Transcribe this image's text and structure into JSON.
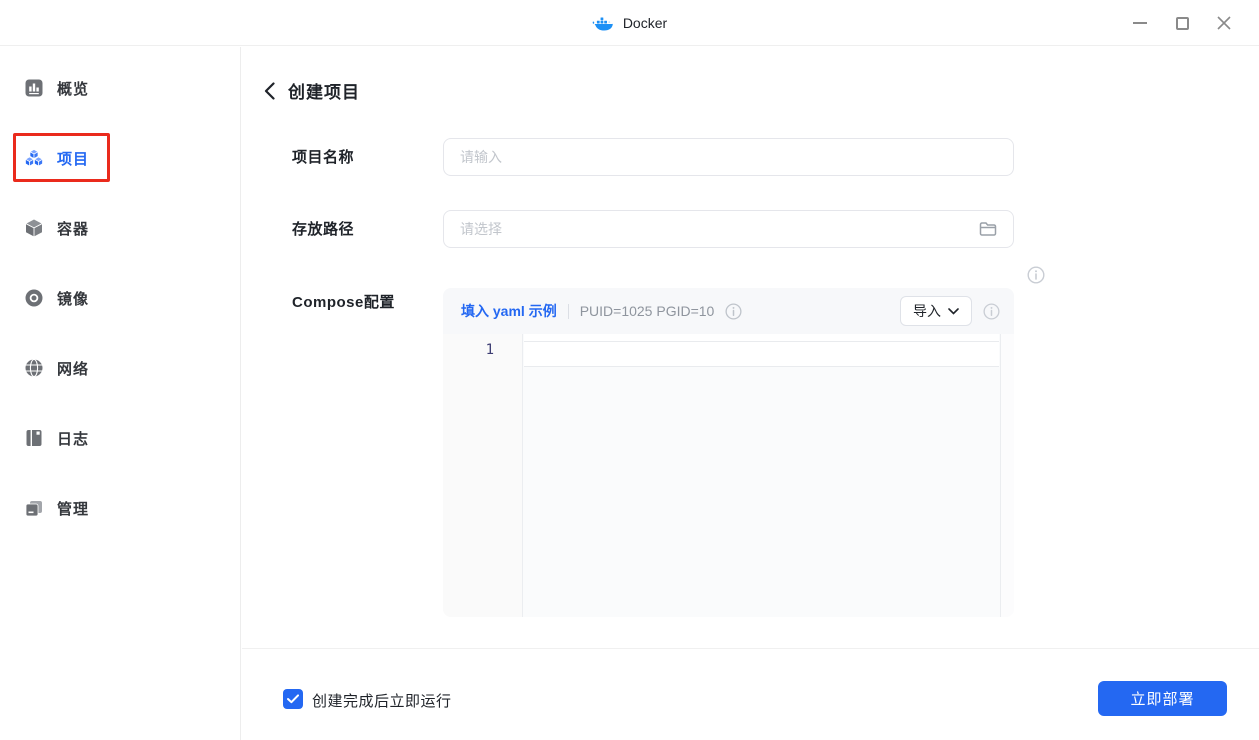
{
  "titlebar": {
    "app_title": "Docker"
  },
  "window_controls": {
    "icons": [
      "minimize-icon",
      "maximize-icon",
      "close-icon"
    ]
  },
  "sidebar": {
    "items": [
      {
        "label": "概览",
        "icon": "overview-icon",
        "active": false
      },
      {
        "label": "项目",
        "icon": "projects-icon",
        "active": true,
        "annotated": true
      },
      {
        "label": "容器",
        "icon": "containers-icon",
        "active": false
      },
      {
        "label": "镜像",
        "icon": "images-icon",
        "active": false
      },
      {
        "label": "网络",
        "icon": "network-icon",
        "active": false
      },
      {
        "label": "日志",
        "icon": "logs-icon",
        "active": false
      },
      {
        "label": "管理",
        "icon": "manage-icon",
        "active": false
      }
    ]
  },
  "main": {
    "page_title": "创建项目",
    "form": {
      "name_label": "项目名称",
      "name_placeholder": "请输入",
      "path_label": "存放路径",
      "path_placeholder": "请选择",
      "compose_label": "Compose配置",
      "yaml_example_link": "填入 yaml 示例",
      "puid_text": "PUID=1025 PGID=10",
      "import_button": "导入",
      "editor": {
        "line_number": "1",
        "content": ""
      }
    },
    "footer": {
      "run_after_create_label": "创建完成后立即运行",
      "checkbox_checked": true,
      "deploy_button": "立即部署"
    }
  },
  "colors": {
    "accent_blue": "#2468f2",
    "annotation_red": "#ea2a1c",
    "toolbar_bg": "#f7f8fa",
    "muted_text": "#8f959e",
    "placeholder": "#c2c6cc"
  }
}
